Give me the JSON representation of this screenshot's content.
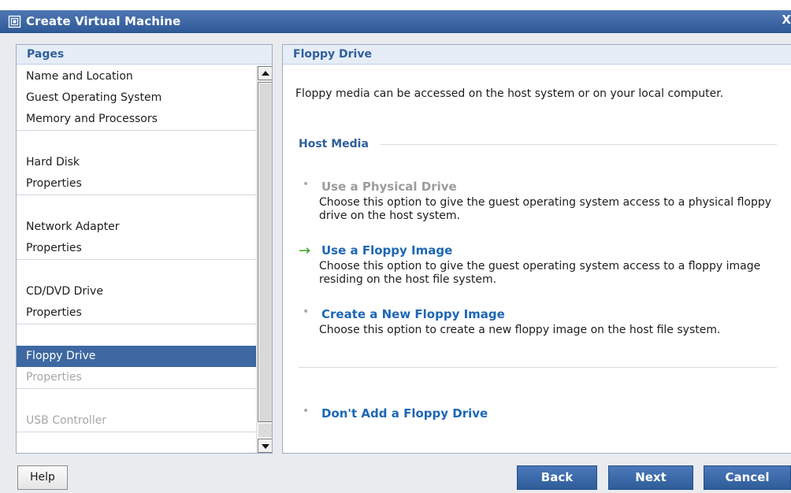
{
  "window": {
    "title": "Create Virtual Machine",
    "icon": "virtual-machine-icon",
    "close_glyph": "X"
  },
  "pages_panel": {
    "header": "Pages",
    "groups": [
      {
        "items": [
          {
            "label": "Name and Location",
            "state": "normal"
          },
          {
            "label": "Guest Operating System",
            "state": "normal"
          },
          {
            "label": "Memory and Processors",
            "state": "normal"
          }
        ]
      },
      {
        "items": [
          {
            "label": "Hard Disk",
            "state": "normal"
          },
          {
            "label": "Properties",
            "state": "normal"
          }
        ]
      },
      {
        "items": [
          {
            "label": "Network Adapter",
            "state": "normal"
          },
          {
            "label": "Properties",
            "state": "normal"
          }
        ]
      },
      {
        "items": [
          {
            "label": "CD/DVD Drive",
            "state": "normal"
          },
          {
            "label": "Properties",
            "state": "normal"
          }
        ]
      },
      {
        "items": [
          {
            "label": "Floppy Drive",
            "state": "selected"
          },
          {
            "label": "Properties",
            "state": "disabled"
          }
        ]
      },
      {
        "items": [
          {
            "label": "USB Controller",
            "state": "disabled"
          }
        ]
      }
    ]
  },
  "content": {
    "header": "Floppy Drive",
    "intro": "Floppy media can be accessed on the host system or on your local computer.",
    "section_heading": "Host Media",
    "options": [
      {
        "title": "Use a Physical Drive",
        "description": "Choose this option to give the guest operating system access to a physical floppy drive on the host system.",
        "state": "disabled",
        "marker": "•"
      },
      {
        "title": "Use a Floppy Image",
        "description": "Choose this option to give the guest operating system access to a floppy image residing on the host file system.",
        "state": "current",
        "marker": "→"
      },
      {
        "title": "Create a New Floppy Image",
        "description": "Choose this option to create a new floppy image on the host file system.",
        "state": "normal",
        "marker": "•"
      },
      {
        "title": "Don't Add a Floppy Drive",
        "description": "",
        "state": "normal",
        "marker": "•"
      }
    ]
  },
  "footer": {
    "help_label": "Help",
    "back_label": "Back",
    "next_label": "Next",
    "cancel_label": "Cancel"
  },
  "colors": {
    "title_bar": "#3d67a6",
    "header_text": "#2f5f9d",
    "selected_row": "#3e68a1",
    "link_blue": "#1d67b5",
    "arrow_green": "#38a21f",
    "button_blue": "#3f6fae"
  }
}
